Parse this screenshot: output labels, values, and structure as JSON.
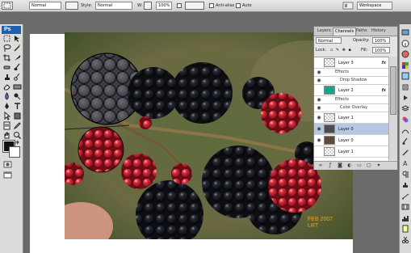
{
  "options_bar": {
    "style_label": "Style:",
    "style_value": "Normal",
    "width_label": "W:",
    "height_label": "H:",
    "zoom_value": "100%",
    "checkbox1_label": "Anti-alias",
    "checkbox2_label": "Auto",
    "workspace_label": "Workspace"
  },
  "layers_panel": {
    "tabs": [
      "Layers",
      "Channels",
      "Paths",
      "History"
    ],
    "blend_mode": "Normal",
    "opacity_label": "Opacity:",
    "opacity_value": "100%",
    "lock_label": "Lock:",
    "fill_label": "Fill:",
    "fill_value": "100%",
    "layers": [
      {
        "name": "Layer 3",
        "fx": "fx",
        "effects_label": "Effects",
        "effect": "Drop Shadow"
      },
      {
        "name": "Layer 2",
        "fx": "fx",
        "effects_label": "Effects",
        "effect": "Color Overlay"
      },
      {
        "name": "Layer 0",
        "selected": true
      },
      {
        "name": "Layer 1"
      }
    ]
  },
  "canvas": {
    "watermark_line1": "FEB 2007",
    "watermark_line2": "LRT"
  },
  "colors": {
    "panel_bg": "#e4e4e4",
    "selected_layer": "#b4c8e0",
    "ps_badge": "#1f5fb0",
    "watermark": "#e9a230",
    "thumb_teal": "#17a58c"
  },
  "icons": [
    "marquee-icon",
    "move-icon",
    "lasso-icon",
    "magic-wand-icon",
    "crop-icon",
    "slice-icon",
    "healing-icon",
    "brush-icon",
    "stamp-icon",
    "history-brush-icon",
    "eraser-icon",
    "gradient-icon",
    "blur-icon",
    "dodge-icon",
    "pen-icon",
    "text-icon",
    "path-select-icon",
    "shape-icon",
    "notes-icon",
    "eyedropper-icon",
    "hand-icon",
    "zoom-icon"
  ]
}
